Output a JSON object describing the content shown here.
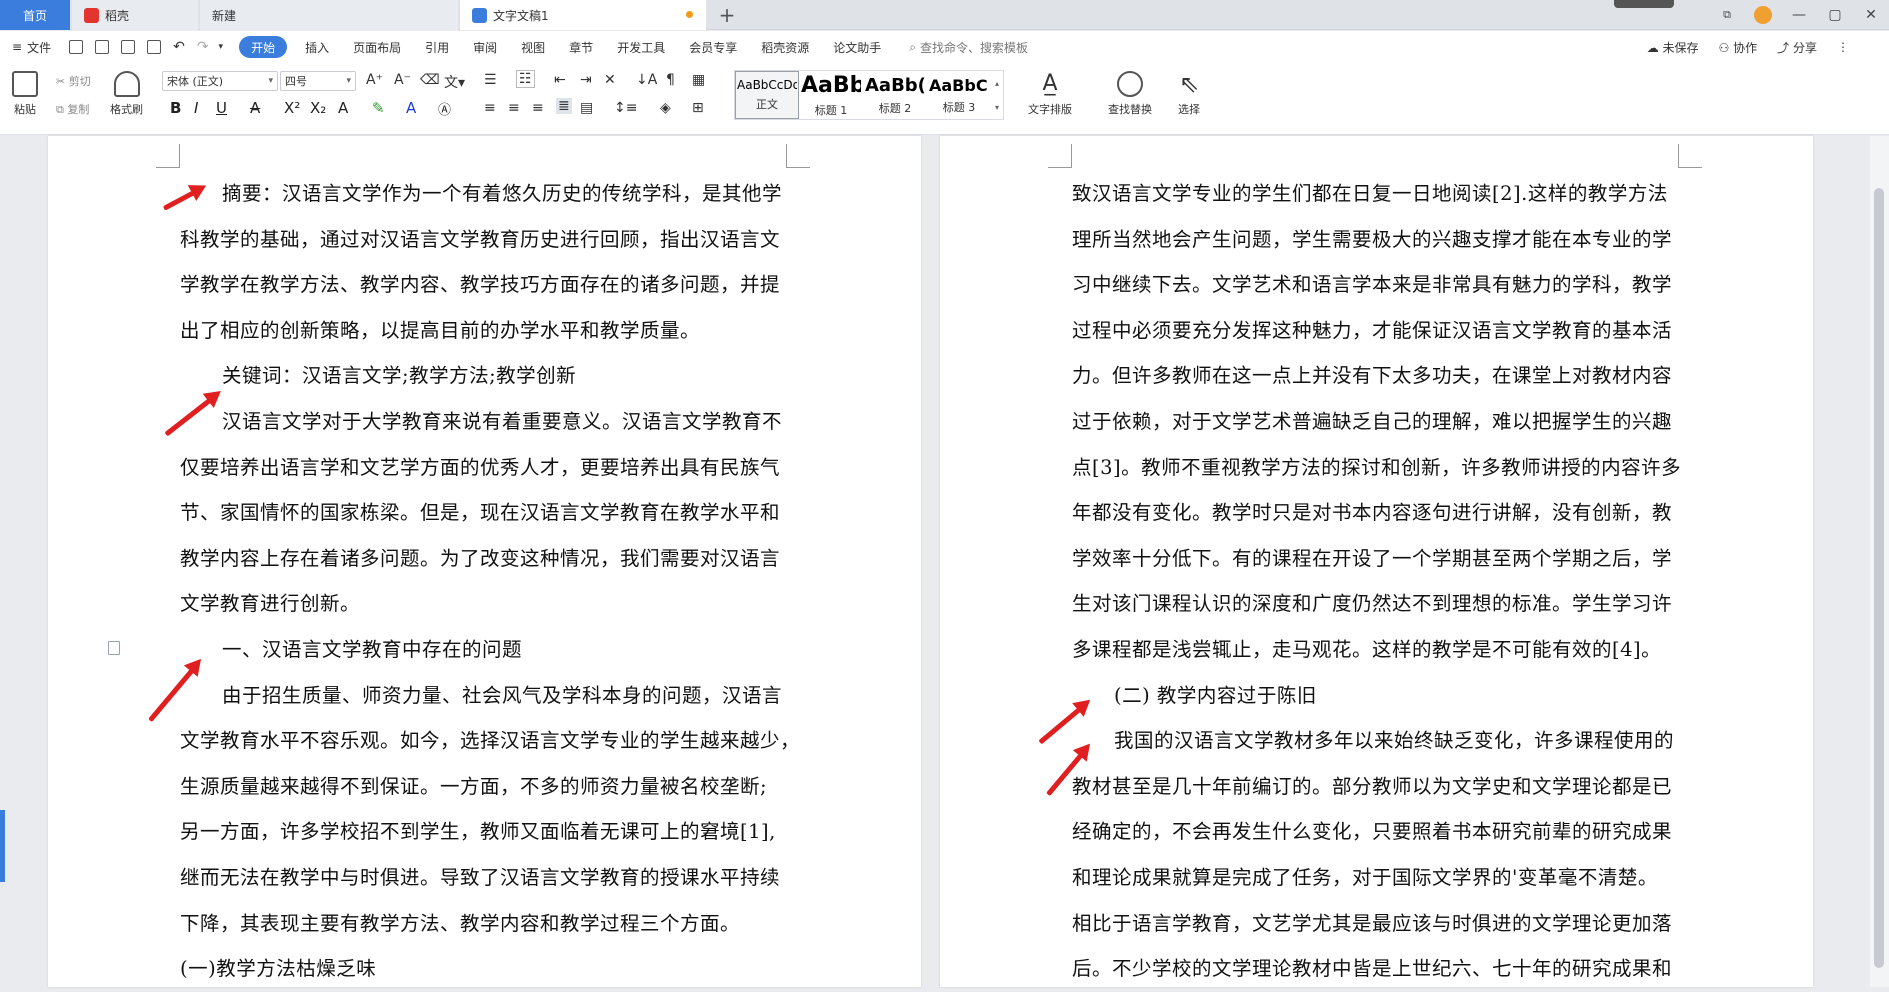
{
  "tabs": {
    "home": "首页",
    "daoke": "稻壳",
    "new": "新建",
    "doc": "文字文稿1",
    "plus": "+"
  },
  "window": {
    "minimize": "—",
    "maximize": "▢",
    "close": "✕"
  },
  "menu": {
    "file": "文件",
    "items": [
      "开始",
      "插入",
      "页面布局",
      "引用",
      "审阅",
      "视图",
      "章节",
      "开发工具",
      "会员专享",
      "稻壳资源",
      "论文助手"
    ],
    "search": "查找命令、搜索模板",
    "unsaved": "未保存",
    "collab": "协作",
    "share": "分享"
  },
  "ribbon": {
    "paste": "粘贴",
    "cut": "剪切",
    "copy": "复制",
    "format_painter": "格式刷",
    "font_name": "宋体 (正文)",
    "font_size": "四号",
    "styles": [
      {
        "preview": "AaBbCcDd",
        "name": "正文"
      },
      {
        "preview": "AaBb",
        "name": "标题 1"
      },
      {
        "preview": "AaBb(",
        "name": "标题 2"
      },
      {
        "preview": "AaBbC(",
        "name": "标题 3"
      }
    ],
    "text_layout": "文字排版",
    "find_replace": "查找替换",
    "select": "选择"
  },
  "page1": [
    "摘要：汉语言文学作为一个有着悠久历史的传统学科，是其他学",
    "科教学的基础，通过对汉语言文学教育历史进行回顾，指出汉语言文",
    "学教学在教学方法、教学内容、教学技巧方面存在的诸多问题，并提",
    "出了相应的创新策略，以提高目前的办学水平和教学质量。",
    "关键词：汉语言文学;教学方法;教学创新",
    "汉语言文学对于大学教育来说有着重要意义。汉语言文学教育不",
    "仅要培养出语言学和文艺学方面的优秀人才，更要培养出具有民族气",
    "节、家国情怀的国家栋梁。但是，现在汉语言文学教育在教学水平和",
    "教学内容上存在着诸多问题。为了改变这种情况，我们需要对汉语言",
    "文学教育进行创新。",
    "一、汉语言文学教育中存在的问题",
    "由于招生质量、师资力量、社会风气及学科本身的问题，汉语言",
    "文学教育水平不容乐观。如今，选择汉语言文学专业的学生越来越少，",
    "生源质量越来越得不到保证。一方面，不多的师资力量被名校垄断;",
    "另一方面，许多学校招不到学生，教师又面临着无课可上的窘境[1],",
    "继而无法在教学中与时俱进。导致了汉语言文学教育的授课水平持续",
    "下降，其表现主要有教学方法、教学内容和教学过程三个方面。",
    "(一)教学方法枯燥乏味"
  ],
  "page2": [
    "致汉语言文学专业的学生们都在日复一日地阅读[2].这样的教学方法",
    "理所当然地会产生问题，学生需要极大的兴趣支撑才能在本专业的学",
    "习中继续下去。文学艺术和语言学本来是非常具有魅力的学科，教学",
    "过程中必须要充分发挥这种魅力，才能保证汉语言文学教育的基本活",
    "力。但许多教师在这一点上并没有下太多功夫，在课堂上对教材内容",
    "过于依赖，对于文学艺术普遍缺乏自己的理解，难以把握学生的兴趣",
    "点[3]。教师不重视教学方法的探讨和创新，许多教师讲授的内容许多",
    "年都没有变化。教学时只是对书本内容逐句进行讲解，没有创新，教",
    "学效率十分低下。有的课程在开设了一个学期甚至两个学期之后，学",
    "生对该门课程认识的深度和广度仍然达不到理想的标准。学生学习许",
    "多课程都是浅尝辄止，走马观花。这样的教学是不可能有效的[4]。",
    "(二)   教学内容过于陈旧",
    "我国的汉语言文学教材多年以来始终缺乏变化，许多课程使用的",
    "教材甚至是几十年前编订的。部分教师以为文学史和文学理论都是已",
    "经确定的，不会再发生什么变化，只要照着书本研究前辈的研究成果",
    "和理论成果就算是完成了任务，对于国际文学界的'变革毫不清楚。",
    "相比于语言学教育，文艺学尤其是最应该与时俱进的文学理论更加落",
    "后。不少学校的文学理论教材中皆是上世纪六、七十年的研究成果和"
  ],
  "colors": {
    "accent": "#3b7ddd",
    "arrow": "#e02020",
    "dot": "#f29b1a"
  }
}
